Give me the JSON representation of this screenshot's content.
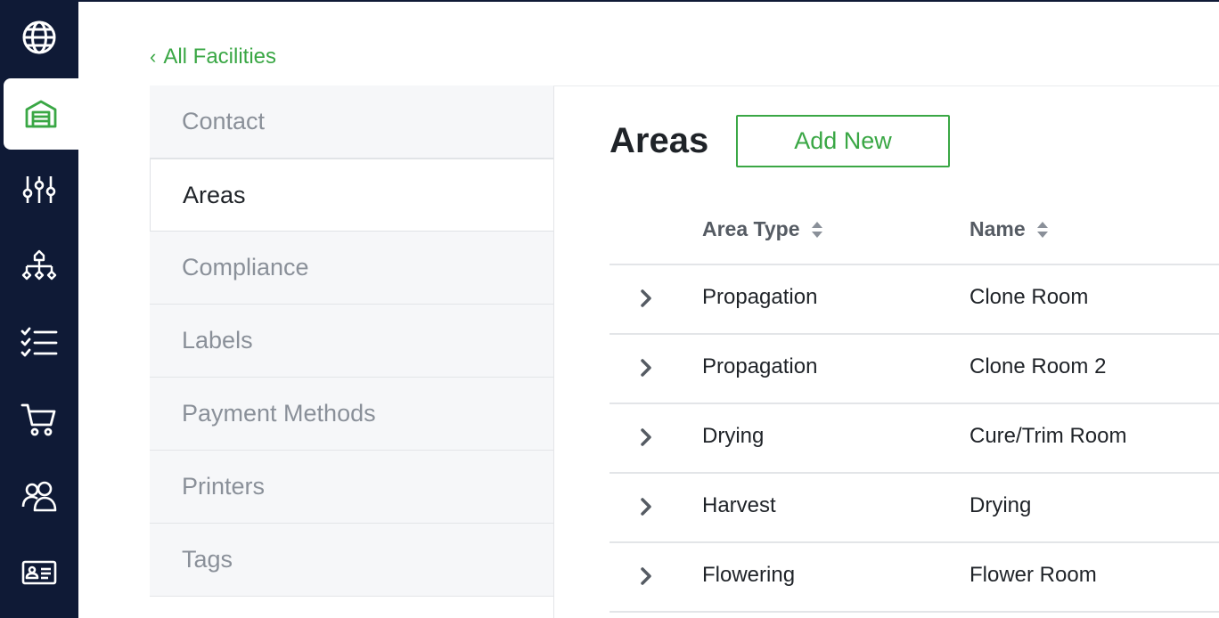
{
  "sidebar": {
    "items": [
      {
        "icon": "globe-icon"
      },
      {
        "icon": "warehouse-icon",
        "active": true
      },
      {
        "icon": "sliders-icon"
      },
      {
        "icon": "hierarchy-icon"
      },
      {
        "icon": "checklist-icon"
      },
      {
        "icon": "cart-icon"
      },
      {
        "icon": "users-icon"
      },
      {
        "icon": "id-card-icon"
      }
    ]
  },
  "back_link": {
    "label": "All Facilities",
    "icon": "chevron-left-icon"
  },
  "subnav": {
    "items": [
      {
        "label": "Contact"
      },
      {
        "label": "Areas",
        "active": true
      },
      {
        "label": "Compliance"
      },
      {
        "label": "Labels"
      },
      {
        "label": "Payment Methods"
      },
      {
        "label": "Printers"
      },
      {
        "label": "Tags"
      }
    ]
  },
  "main": {
    "title": "Areas",
    "add_button": "Add New"
  },
  "table": {
    "columns": [
      {
        "label": "Area Type",
        "icon": "sort-icon"
      },
      {
        "label": "Name",
        "icon": "sort-icon"
      }
    ],
    "rows": [
      {
        "area_type": "Propagation",
        "name": "Clone Room"
      },
      {
        "area_type": "Propagation",
        "name": "Clone Room 2"
      },
      {
        "area_type": "Drying",
        "name": "Cure/Trim Room"
      },
      {
        "area_type": "Harvest",
        "name": "Drying"
      },
      {
        "area_type": "Flowering",
        "name": "Flower Room"
      }
    ]
  },
  "colors": {
    "sidebar_bg": "#0f1a36",
    "accent_green": "#3aa745",
    "subnav_bg": "#f6f7f9"
  }
}
